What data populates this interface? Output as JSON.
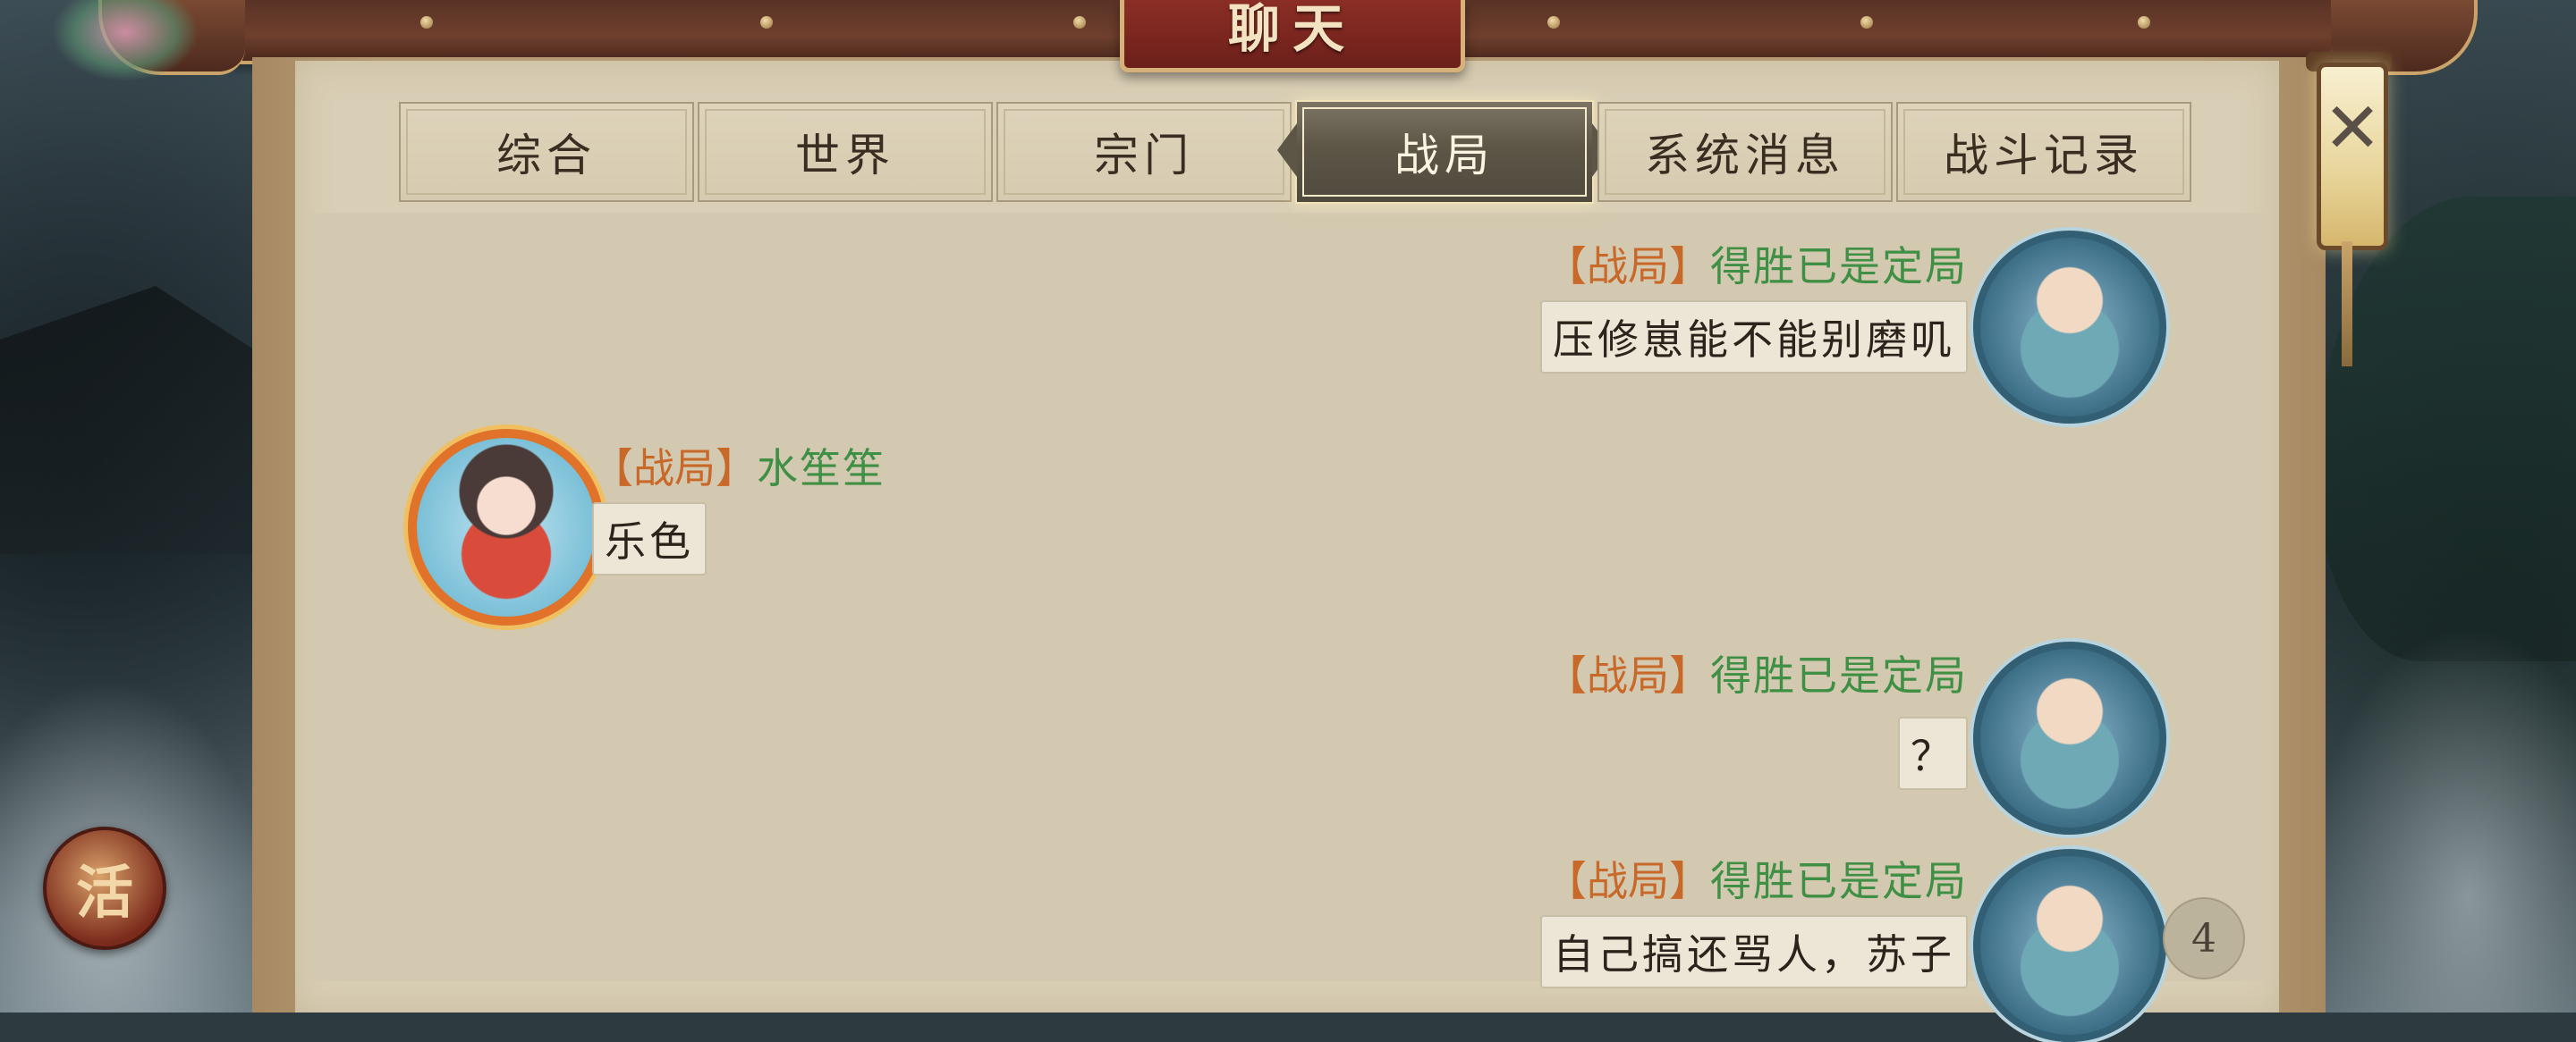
{
  "window": {
    "title": "聊天"
  },
  "tabs": [
    {
      "label": "综合",
      "active": false
    },
    {
      "label": "世界",
      "active": false
    },
    {
      "label": "宗门",
      "active": false
    },
    {
      "label": "战局",
      "active": true
    },
    {
      "label": "系统消息",
      "active": false
    },
    {
      "label": "战斗记录",
      "active": false
    }
  ],
  "messages": [
    {
      "side": "right",
      "tag": "【战局】",
      "sender": "得胜已是定局",
      "text": "压修崽能不能别磨叽",
      "avatar": "female-cultivator-avatar"
    },
    {
      "side": "left",
      "tag": "【战局】",
      "sender": "水笙笙",
      "text": "乐色",
      "avatar": "chibi-girl-avatar"
    },
    {
      "side": "right",
      "tag": "【战局】",
      "sender": "得胜已是定局",
      "text": "？",
      "avatar": "female-cultivator-avatar"
    },
    {
      "side": "right",
      "tag": "【战局】",
      "sender": "得胜已是定局",
      "text": "自己搞还骂人，苏子",
      "avatar": "female-cultivator-avatar"
    }
  ],
  "unread_count": "4",
  "activity_badge": {
    "label": "活"
  },
  "close_button": {
    "icon": "close-icon",
    "glyph": "✕"
  },
  "colors": {
    "channel_tag": "#c8692a",
    "sender_name": "#3f8f45",
    "panel_background": "#d9cfb6",
    "title_plaque": "#8b2e25"
  }
}
